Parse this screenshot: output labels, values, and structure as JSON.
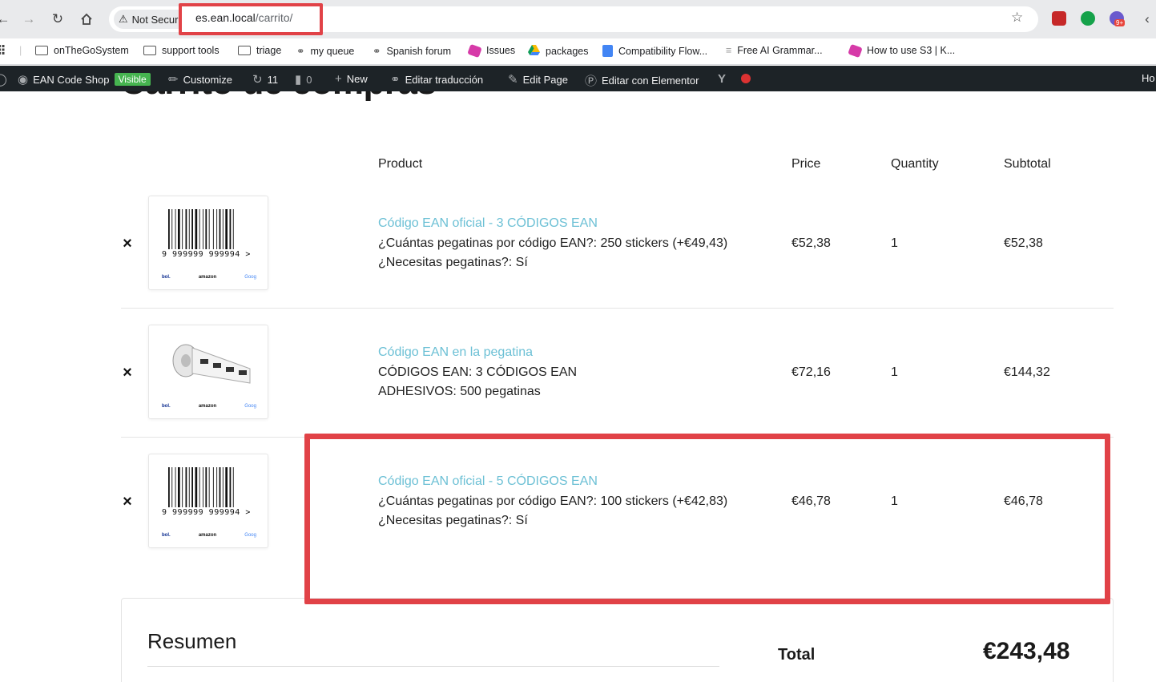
{
  "browser": {
    "security_label": "Not Secure",
    "url_host": "es.ean.local",
    "url_path": "/carrito/",
    "extension_badge": "9+",
    "bookmarks": [
      "onTheGoSystem",
      "support tools",
      "triage",
      "my queue",
      "Spanish forum",
      "Issues",
      "packages",
      "Compatibility Flow...",
      "Free AI Grammar...",
      "How to use S3 | K..."
    ]
  },
  "adminbar": {
    "site_name": "EAN Code Shop",
    "visible_badge": "Visible",
    "customize": "Customize",
    "updates_count": "11",
    "comments_count": "0",
    "new": "New",
    "translate": "Editar traducción",
    "edit_page": "Edit Page",
    "elementor": "Editar con Elementor",
    "right_item": "Ho"
  },
  "page": {
    "heading": "Carrito de compras"
  },
  "cart": {
    "headers": {
      "product": "Product",
      "price": "Price",
      "quantity": "Quantity",
      "subtotal": "Subtotal"
    },
    "remove_symbol": "×",
    "items": [
      {
        "name": "Código EAN oficial - 3 CÓDIGOS EAN",
        "meta": [
          "¿Cuántas pegatinas por código EAN?: 250 stickers (+€49,43)",
          "¿Necesitas pegatinas?: Sí"
        ],
        "price": "€52,38",
        "quantity": "1",
        "subtotal": "€52,38",
        "image": "barcode"
      },
      {
        "name": "Código EAN en la pegatina",
        "meta": [
          "CÓDIGOS EAN: 3 CÓDIGOS EAN",
          "ADHESIVOS: 500 pegatinas"
        ],
        "price": "€72,16",
        "quantity": "1",
        "subtotal": "€144,32",
        "image": "sticker-rolls"
      },
      {
        "name": "Código EAN oficial - 5 CÓDIGOS EAN",
        "meta": [
          "¿Cuántas pegatinas por código EAN?: 100 stickers (+€42,83)",
          "¿Necesitas pegatinas?: Sí"
        ],
        "price": "€46,78",
        "quantity": "1",
        "subtotal": "€46,78",
        "image": "barcode"
      }
    ],
    "barcode_digits": "9 999999 999994 >",
    "logos": {
      "bol": "bol.",
      "amazon": "amazon",
      "google": "Goog"
    }
  },
  "summary": {
    "title": "Resumen",
    "total_label": "Total",
    "total_value": "€243,48"
  },
  "colors": {
    "link": "#6cc0d5",
    "highlight": "#e14247",
    "adminbar": "#1d2327",
    "visible_badge": "#46b450"
  }
}
